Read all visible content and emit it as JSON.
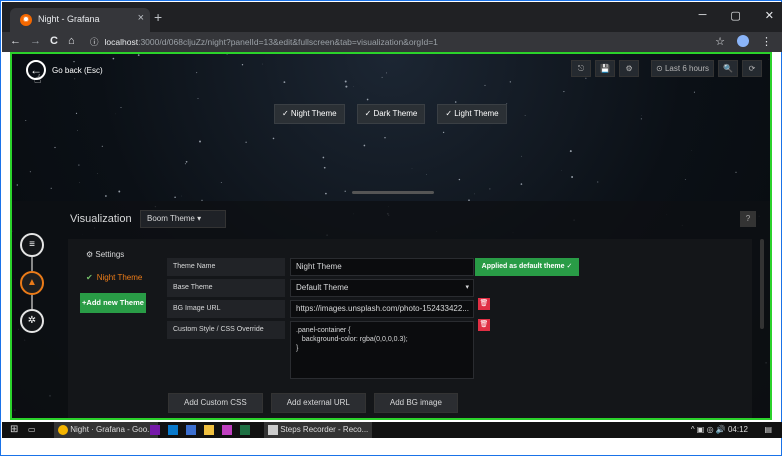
{
  "browser": {
    "tab_title": "Night - Grafana",
    "tab_close": "×",
    "new_tab": "+",
    "window_controls": [
      "─",
      "▢",
      "✕"
    ],
    "url_info": "ⓘ",
    "url_host": "localhost",
    "url_rest": ":3000/d/068cljuZz/night?panelId=13&edit&fullscreen&tab=visualization&orgId=1",
    "back": "←",
    "forward": "→",
    "reload": "C",
    "home": "⌂",
    "star": "☆",
    "menu": "⋮"
  },
  "grafana": {
    "go_back_label": "Go back (Esc)",
    "go_back_icon": "←",
    "toolbar_icons": [
      "⎋",
      "💾",
      "⚙"
    ],
    "time_range": "⊙ Last 6 hours",
    "zoom_icon": "🔍",
    "refresh_icon": "⟳",
    "theme_buttons": [
      "✓ Night Theme",
      "✓ Dark Theme",
      "✓ Light Theme"
    ],
    "visualization_label": "Visualization",
    "viz_select": "Boom Theme ▾",
    "help": "?",
    "sidebar": {
      "settings": "⚙  Settings",
      "night_theme": "Night Theme",
      "add_new_theme": "+Add new Theme"
    },
    "form": {
      "theme_name_label": "Theme Name",
      "theme_name_value": "Night Theme",
      "base_theme_label": "Base Theme",
      "base_theme_value": "Default Theme",
      "bg_image_label": "BG Image URL",
      "bg_image_value": "https://images.unsplash.com/photo-152433422...",
      "custom_style_label": "Custom Style / CSS Override",
      "custom_style_value": ".panel-container {\n   background-color: rgba(0,0,0,0.3);\n}",
      "applied_button": "Applied as default theme ✓"
    },
    "bottom_buttons": [
      "Add Custom CSS",
      "Add external URL",
      "Add BG image"
    ]
  },
  "taskbar": {
    "start": "⊞",
    "items": [
      "Night · Grafana - Goo...",
      "Steps Recorder - Reco..."
    ],
    "tray": "^ ▣ ◎ 🔊 04:12"
  },
  "colors": {
    "accent_green": "#299c46",
    "accent_orange": "#eb7b18",
    "danger_red": "#e02f44",
    "highlight_border": "#2bd22b"
  }
}
